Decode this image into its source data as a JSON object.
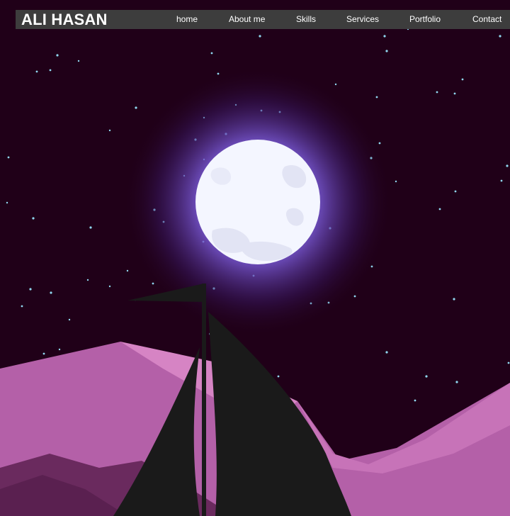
{
  "brand": {
    "name": "ALI HASAN"
  },
  "nav": {
    "items": [
      {
        "label": "home"
      },
      {
        "label": "About me"
      },
      {
        "label": "Skills"
      },
      {
        "label": "Services"
      },
      {
        "label": "Portfolio"
      },
      {
        "label": "Contact"
      }
    ]
  },
  "hero": {
    "illustration": "night-sky-moon-sailboat",
    "colors": {
      "sky": "#200018",
      "moon": "#f4f6ff",
      "moon_glow": "#7a5ad8",
      "stars": "#8fd8f0",
      "mountains_front": "#b460a8",
      "mountains_back": "#d684c4",
      "mountains_far": "#6a2a5e",
      "sail": "#1a1a1a"
    }
  },
  "theme": {
    "navbar_bg": "#3d3d3d",
    "navbar_text": "#ffffff"
  }
}
